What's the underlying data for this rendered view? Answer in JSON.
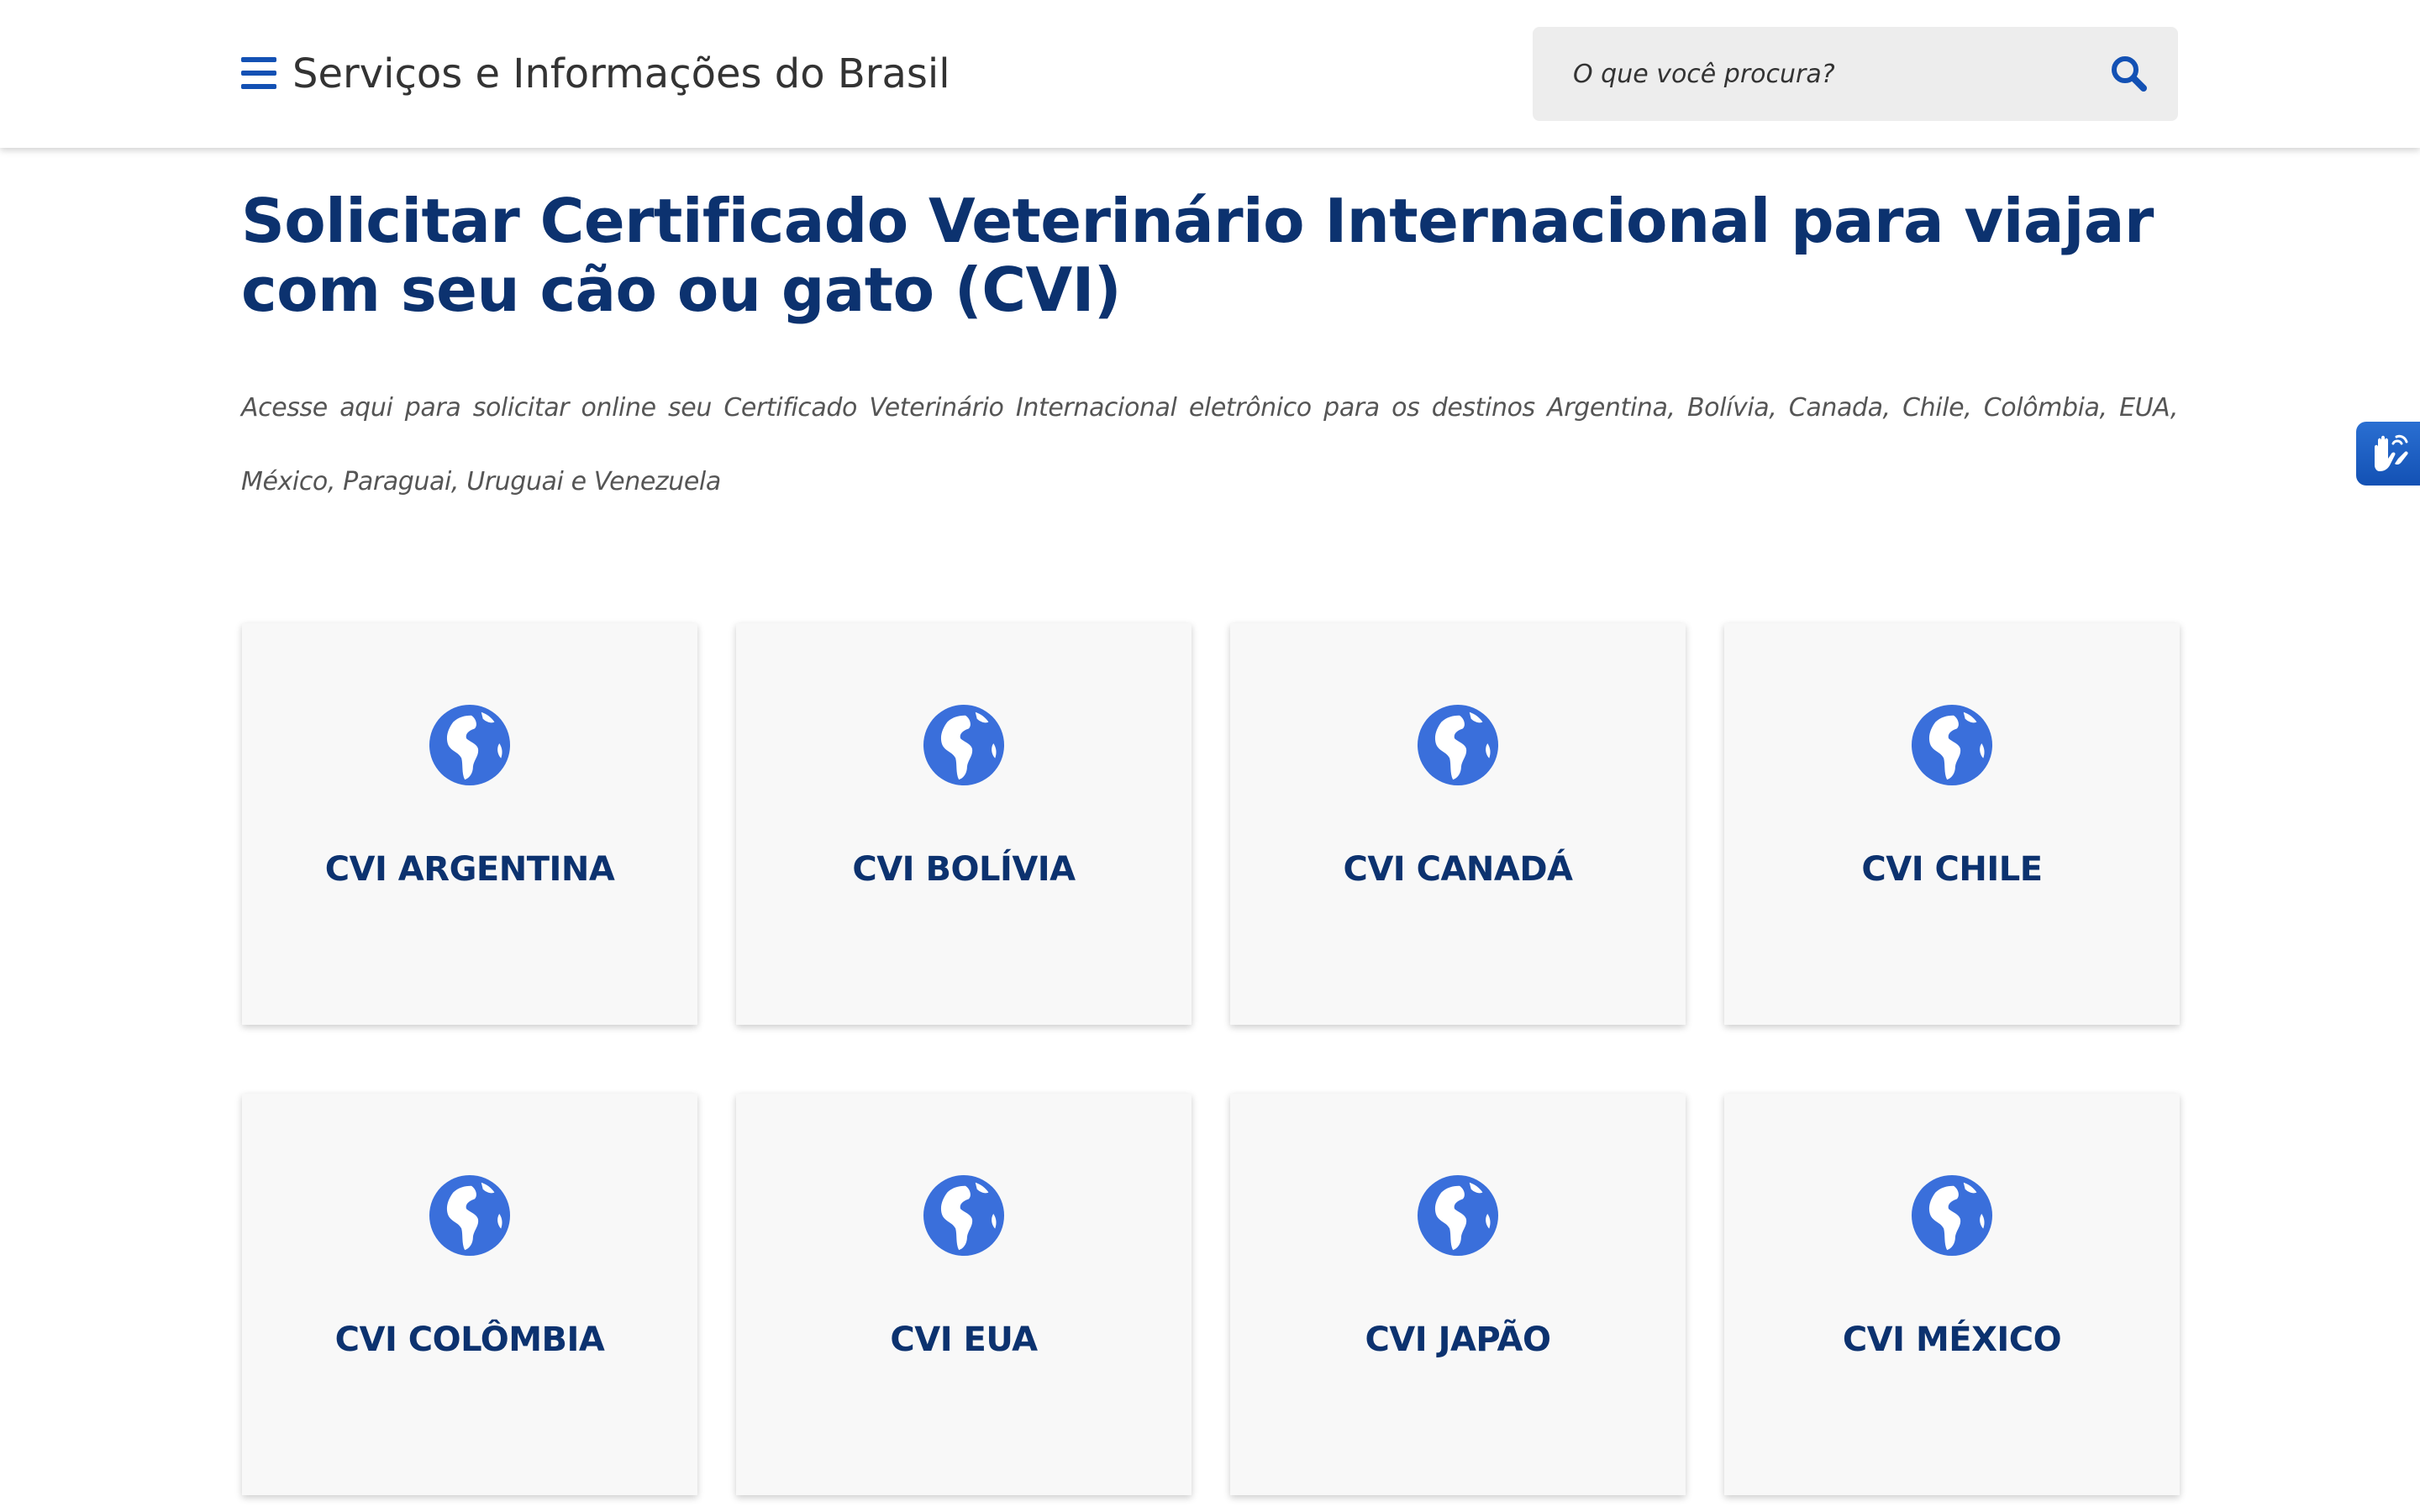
{
  "header": {
    "site_title": "Serviços e Informações do Brasil",
    "search_placeholder": "O que você procura?"
  },
  "page": {
    "title": "Solicitar Certificado Veterinário Internacional para viajar com seu cão ou gato (CVI)",
    "subtitle": "Acesse aqui para solicitar online seu Certificado Veterinário Internacional eletrônico para os destinos Argentina, Bolívia, Canada, Chile, Colômbia, EUA, México, Paraguai, Uruguai e Venezuela"
  },
  "cards": [
    {
      "label": "CVI ARGENTINA",
      "icon": "globe-icon"
    },
    {
      "label": "CVI BOLÍVIA",
      "icon": "globe-icon"
    },
    {
      "label": "CVI CANADÁ",
      "icon": "globe-icon"
    },
    {
      "label": "CVI CHILE",
      "icon": "globe-icon"
    },
    {
      "label": "CVI COLÔMBIA",
      "icon": "globe-icon"
    },
    {
      "label": "CVI EUA",
      "icon": "globe-icon"
    },
    {
      "label": "CVI JAPÃO",
      "icon": "globe-icon"
    },
    {
      "label": "CVI MÉXICO",
      "icon": "globe-icon"
    }
  ],
  "icons": {
    "menu": "menu-icon",
    "search": "search-icon",
    "accessibility": "sign-language-icon"
  },
  "colors": {
    "primary_blue": "#1351b4",
    "title_navy": "#0c326f",
    "globe_blue": "#3a6fdb",
    "card_bg": "#f8f8f8",
    "search_bg": "#ededed"
  }
}
